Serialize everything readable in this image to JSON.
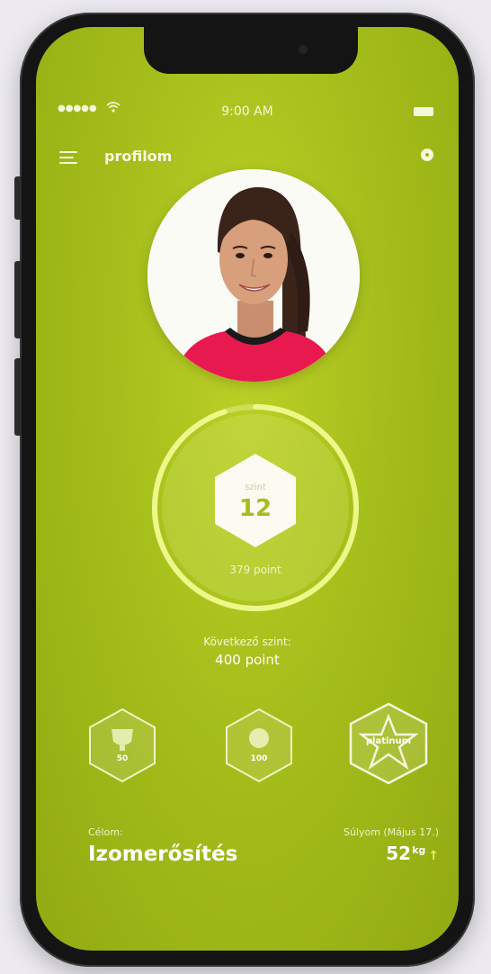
{
  "status_bar": {
    "signal": "●●●●●",
    "wifi_icon": "wifi-icon",
    "time": "9:00 AM",
    "battery_icon": "battery-icon"
  },
  "header": {
    "title": "profilom",
    "menu_icon": "menu-icon",
    "settings_icon": "settings-icon"
  },
  "level": {
    "label": "szint",
    "value": "12",
    "points": "379 point",
    "progress_fraction": 0.95
  },
  "next_level": {
    "label": "Következő szint:",
    "value": "400 point"
  },
  "badges": [
    {
      "name": "trophy-badge",
      "text": "50"
    },
    {
      "name": "medal-badge",
      "text": "100"
    },
    {
      "name": "star-badge",
      "text": "platinum"
    }
  ],
  "goal": {
    "label": "Célom:",
    "value": "Izomerősítés"
  },
  "weight": {
    "label": "Súlyom (Május 17.)",
    "value": "52",
    "unit": "kg",
    "trend": "↑"
  },
  "colors": {
    "screen_bg": "#a5be1b",
    "accent": "#e3f25c",
    "text_light": "#f4f8dc"
  }
}
